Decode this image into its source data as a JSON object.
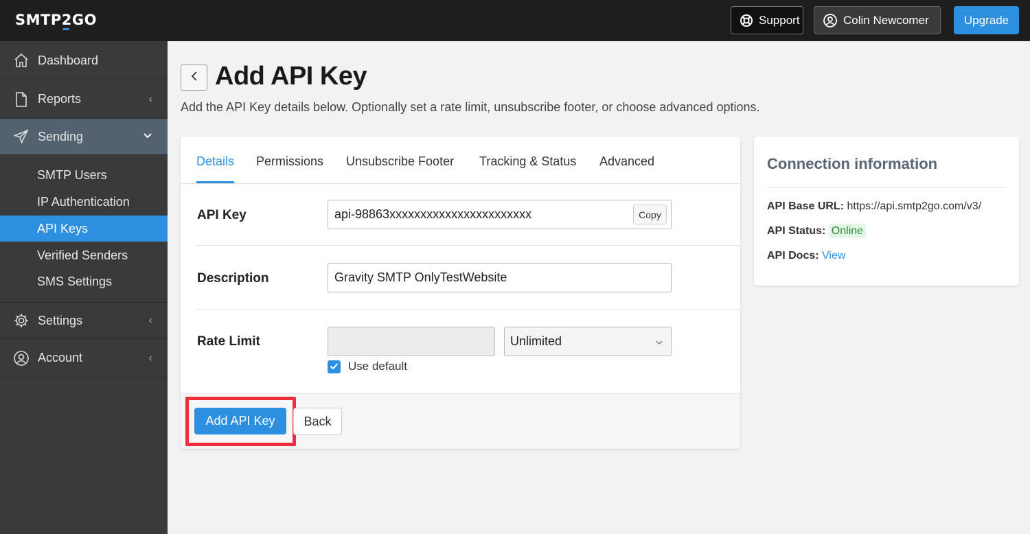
{
  "topbar": {
    "logo": {
      "part1": "SMTP",
      "part2": "2",
      "part3": "GO"
    },
    "support_label": "Support",
    "user_label": "Colin Newcomer",
    "upgrade_label": "Upgrade"
  },
  "sidebar": {
    "items": [
      {
        "label": "Dashboard",
        "icon": "home-icon"
      },
      {
        "label": "Reports",
        "icon": "document-icon"
      },
      {
        "label": "Sending",
        "icon": "paper-plane-icon"
      },
      {
        "label": "Settings",
        "icon": "gear-icon"
      },
      {
        "label": "Account",
        "icon": "user-circle-icon"
      }
    ],
    "sending_sub": [
      {
        "label": "SMTP Users"
      },
      {
        "label": "IP Authentication"
      },
      {
        "label": "API Keys"
      },
      {
        "label": "Verified Senders"
      },
      {
        "label": "SMS Settings"
      }
    ]
  },
  "page": {
    "title": "Add API Key",
    "description": "Add the API Key details below. Optionally set a rate limit, unsubscribe footer, or choose advanced options."
  },
  "tabs": [
    "Details",
    "Permissions",
    "Unsubscribe Footer",
    "Tracking & Status",
    "Advanced"
  ],
  "form": {
    "api_key_label": "API Key",
    "api_key_value": "api-98863xxxxxxxxxxxxxxxxxxxxxxx",
    "copy_label": "Copy",
    "description_label": "Description",
    "description_value": "Gravity SMTP OnlyTestWebsite",
    "rate_limit_label": "Rate Limit",
    "rate_limit_value": "",
    "rate_limit_select": "Unlimited",
    "use_default_label": "Use default",
    "use_default_checked": true
  },
  "footer": {
    "submit_label": "Add API Key",
    "back_label": "Back"
  },
  "connection": {
    "title": "Connection information",
    "base_url_label": "API Base URL:",
    "base_url_value": "https://api.smtp2go.com/v3/",
    "status_label": "API Status:",
    "status_value": "Online",
    "docs_label": "API Docs:",
    "docs_link": "View"
  },
  "colors": {
    "accent": "#2d8fe0",
    "highlight": "#ee2d3d",
    "online": "#2c8a3b"
  }
}
